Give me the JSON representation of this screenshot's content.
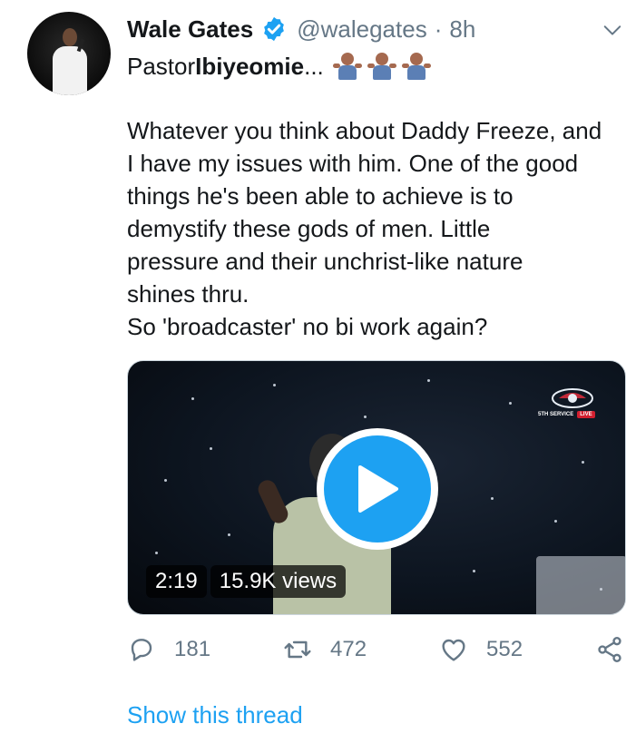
{
  "author": {
    "name": "Wale Gates",
    "handle": "@walegates",
    "separator": "·",
    "time": "8h",
    "verified": true,
    "avatar_icon": "avatar"
  },
  "tweet": {
    "first_line_prefix": "Pastor ",
    "first_line_bold": "Ibiyeomie",
    "first_line_suffix": "...",
    "emoji_name": "man-shrugging-emoji",
    "emoji_count": 3,
    "lines": [
      "Whatever you think about Daddy Freeze, and",
      "I have my issues with him. One of the good",
      "things he's been able to achieve is to",
      "demystify these gods of men. Little",
      "pressure and their unchrist-like nature",
      "shines thru.",
      "So 'broadcaster' no bi work again?"
    ]
  },
  "video": {
    "duration": "2:19",
    "views": "15.9K views",
    "overlay_badge": "LIVE",
    "overlay_text": "5TH SERVICE"
  },
  "actions": {
    "replies": "181",
    "retweets": "472",
    "likes": "552"
  },
  "show_thread": "Show this thread",
  "colors": {
    "accent": "#1da1f2",
    "text": "#14171a",
    "muted": "#657786",
    "live": "#d21f2f"
  }
}
